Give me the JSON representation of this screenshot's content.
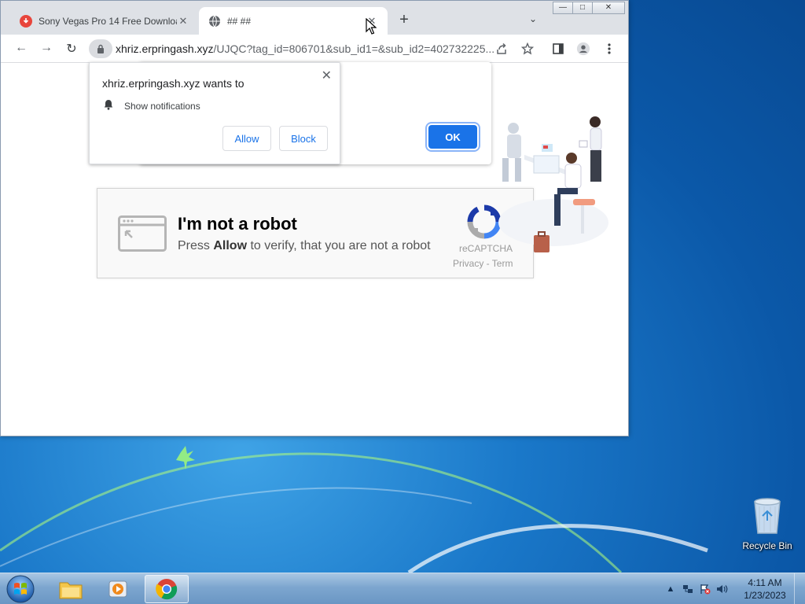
{
  "browser": {
    "tabs": [
      {
        "title": "Sony Vegas Pro 14 Free Download",
        "close_label": "✕"
      },
      {
        "title": "## ##",
        "close_label": "✕"
      }
    ],
    "new_tab_label": "+",
    "tab_search_label": "⌄",
    "window_controls": {
      "minimize": "—",
      "maximize": "□",
      "close": "✕"
    },
    "nav": {
      "back": "←",
      "forward": "→",
      "reload": "↻"
    },
    "url": {
      "domain": "xhriz.erpringash.xyz",
      "path": "/UJQC?tag_id=806701&sub_id1=&sub_id2=402732225..."
    }
  },
  "permission_prompt": {
    "title": "xhriz.erpringash.xyz wants to",
    "permission": "Show notifications",
    "allow_label": "Allow",
    "block_label": "Block",
    "close_label": "✕"
  },
  "alert": {
    "ok_label": "OK"
  },
  "captcha": {
    "title": "I'm not a robot",
    "subtitle_prefix": "Press ",
    "subtitle_bold": "Allow",
    "subtitle_suffix": " to verify, that you are not a robot",
    "brand": "reCAPTCHA",
    "privacy": "Privacy - Term"
  },
  "desktop": {
    "recycle_bin_label": "Recycle Bin"
  },
  "taskbar": {
    "time": "4:11 AM",
    "date": "1/23/2023",
    "tray_expand": "▲"
  },
  "colors": {
    "accent": "#1a73e8",
    "tab_favicon_red": "#e8453c"
  }
}
